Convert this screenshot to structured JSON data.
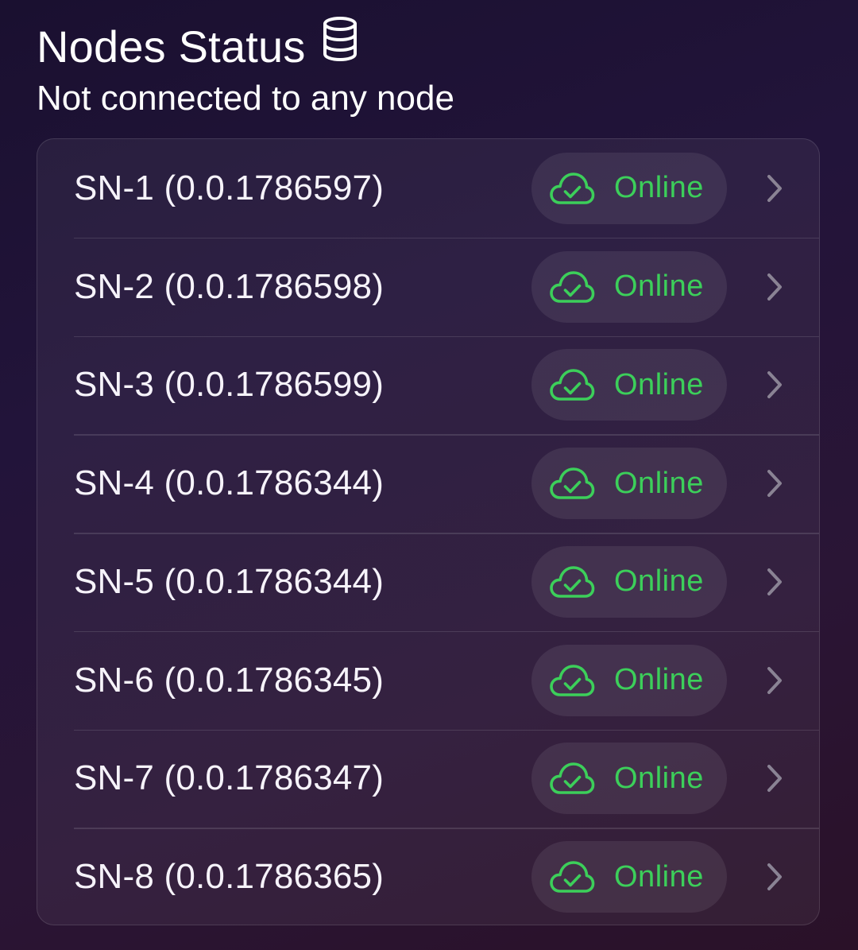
{
  "header": {
    "title": "Nodes Status",
    "title_icon": "database-icon",
    "subtitle": "Not connected to any node"
  },
  "colors": {
    "status_online": "#3ccf5a",
    "chevron": "#8a8394"
  },
  "nodes": [
    {
      "label": "SN-1 (0.0.1786597)",
      "status": "Online",
      "status_icon": "cloud-check-icon"
    },
    {
      "label": "SN-2 (0.0.1786598)",
      "status": "Online",
      "status_icon": "cloud-check-icon"
    },
    {
      "label": "SN-3 (0.0.1786599)",
      "status": "Online",
      "status_icon": "cloud-check-icon"
    },
    {
      "label": "SN-4 (0.0.1786344)",
      "status": "Online",
      "status_icon": "cloud-check-icon"
    },
    {
      "label": "SN-5 (0.0.1786344)",
      "status": "Online",
      "status_icon": "cloud-check-icon"
    },
    {
      "label": "SN-6 (0.0.1786345)",
      "status": "Online",
      "status_icon": "cloud-check-icon"
    },
    {
      "label": "SN-7 (0.0.1786347)",
      "status": "Online",
      "status_icon": "cloud-check-icon"
    },
    {
      "label": "SN-8 (0.0.1786365)",
      "status": "Online",
      "status_icon": "cloud-check-icon"
    }
  ]
}
